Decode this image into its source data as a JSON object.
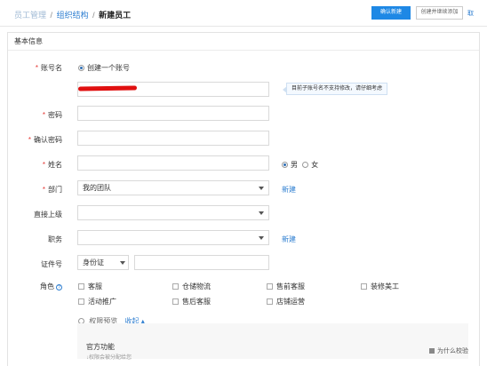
{
  "breadcrumb": {
    "items": [
      "员工管理",
      "组织结构"
    ],
    "current": "新建员工",
    "separator": "/"
  },
  "toolbar": {
    "confirm_label": "确认新建",
    "create_continue_label": "创建并继续添加",
    "extra_label": "取"
  },
  "section": {
    "title": "基本信息"
  },
  "form": {
    "account": {
      "label": "账号名",
      "option": "创建一个账号",
      "tooltip": "目前子账号名不支持修改，请仔细考虑"
    },
    "password": {
      "label": "密码"
    },
    "confirm_password": {
      "label": "确认密码"
    },
    "name": {
      "label": "姓名"
    },
    "gender": {
      "male": "男",
      "female": "女",
      "selected": "male"
    },
    "department": {
      "label": "部门",
      "value": "我的团队",
      "action": "新建"
    },
    "supervisor": {
      "label": "直接上级",
      "value": ""
    },
    "position": {
      "label": "职务",
      "value": "",
      "action": "新建"
    },
    "id_doc": {
      "label": "证件号",
      "type": "身份证",
      "value": ""
    },
    "roles": {
      "label": "角色",
      "help_icon": "?",
      "items": [
        "客服",
        "仓储物流",
        "售前客服",
        "装修美工",
        "活动推广",
        "售后客服",
        "店铺运营"
      ]
    },
    "permission_preview": {
      "label": "权限预览",
      "toggle": "收起"
    }
  },
  "preview": {
    "title": "官方功能",
    "subtitle": "↓权限会被分配给您",
    "footer_label": "为什么校验"
  },
  "colors": {
    "primary": "#1e88e5",
    "link": "#2f7fd1",
    "required": "#e53935"
  }
}
